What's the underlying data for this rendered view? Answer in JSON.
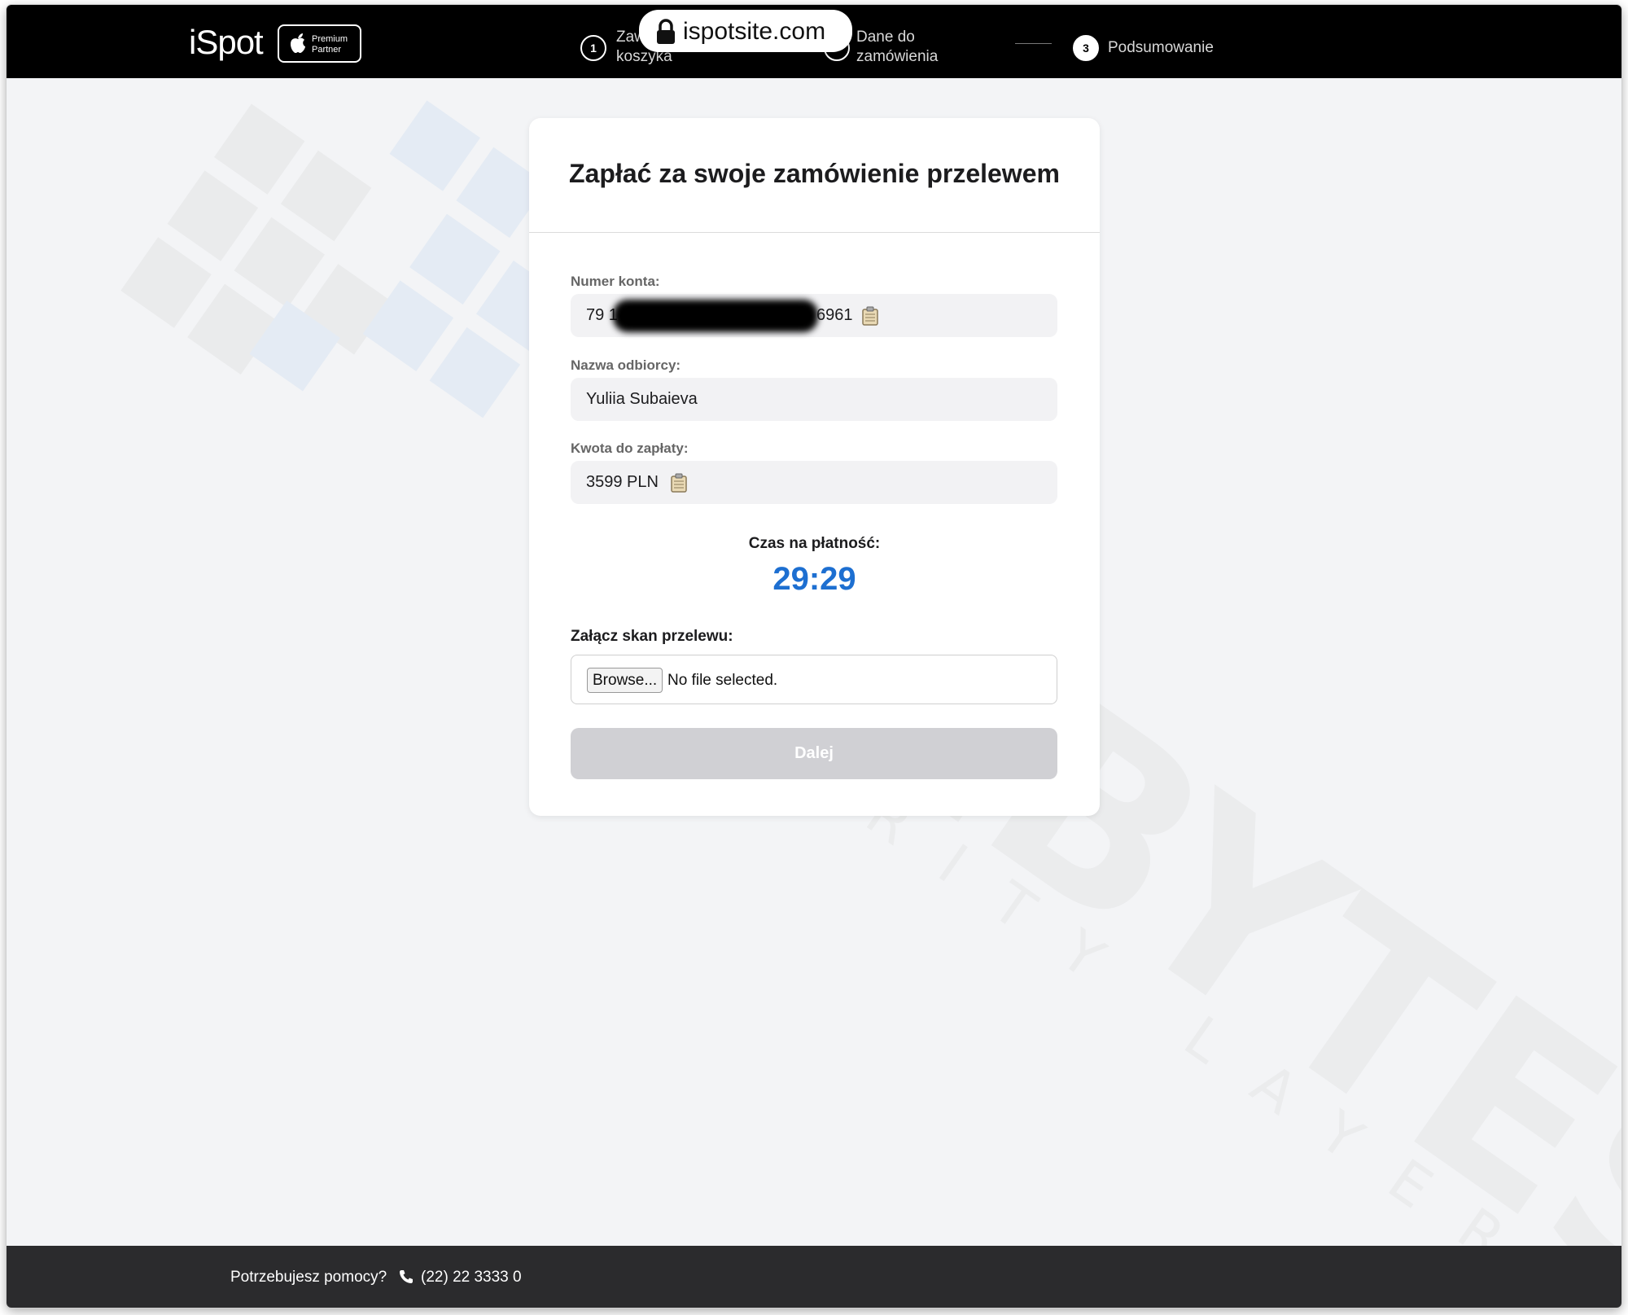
{
  "browser": {
    "url": "ispotsite.com"
  },
  "header": {
    "logo": "iSpot",
    "partner_line1": "Premium",
    "partner_line2": "Partner",
    "steps": [
      {
        "number": "1",
        "line1": "Zaw",
        "line2": "koszyka"
      },
      {
        "number": "",
        "line1": "Dane do",
        "line2": "zamówienia"
      },
      {
        "number": "3",
        "label": "Podsumowanie"
      }
    ]
  },
  "card": {
    "title": "Zapłać za swoje zamówienie przelewem",
    "account_label": "Numer konta:",
    "account_prefix": "79 1",
    "account_suffix": "6961",
    "recipient_label": "Nazwa odbiorcy:",
    "recipient_value": "Yuliia Subaieva",
    "amount_label": "Kwota do zapłaty:",
    "amount_value": "3599 PLN",
    "timer_label": "Czas na płatność:",
    "timer_value": "29:29",
    "upload_label": "Załącz skan przelewu:",
    "browse_label": "Browse...",
    "no_file_text": "No file selected.",
    "submit_label": "Dalej"
  },
  "footer": {
    "help_text": "Potrzebujesz pomocy?",
    "phone": "(22) 22 3333 0"
  },
  "colors": {
    "header_bg": "#000000",
    "page_bg": "#f3f4f6",
    "timer": "#1d6fd1",
    "button_disabled": "#d0d0d4",
    "footer_bg": "#2b2b2d"
  }
}
